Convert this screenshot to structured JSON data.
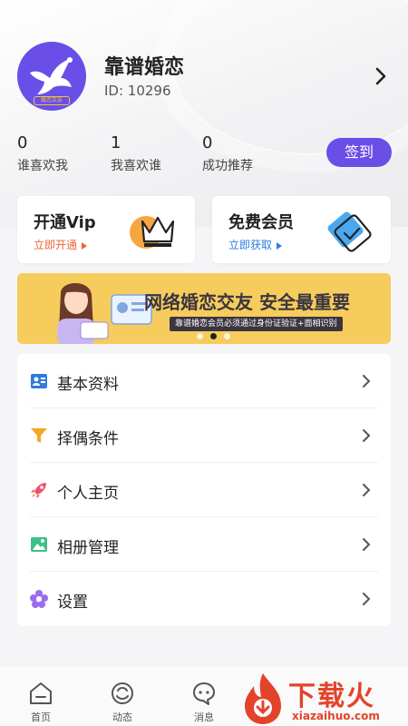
{
  "profile": {
    "app_name": "靠谱婚恋",
    "user_id": "ID: 10296",
    "avatar_badge": "婚恋交友"
  },
  "stats": [
    {
      "value": "0",
      "label": "谁喜欢我"
    },
    {
      "value": "1",
      "label": "我喜欢谁"
    },
    {
      "value": "0",
      "label": "成功推荐"
    }
  ],
  "checkin_label": "签到",
  "cards": {
    "vip": {
      "title": "开通Vip",
      "action": "立即开通",
      "accent": "#f0623a"
    },
    "free": {
      "title": "免费会员",
      "action": "立即获取",
      "accent": "#2f7be0"
    }
  },
  "banner": {
    "headline": "网络婚恋交友 安全最重要",
    "subline": "靠谱婚恋会员必须通过身份证验证+面相识别",
    "slides": 3,
    "active_slide": 2
  },
  "menu": [
    {
      "label": "基本资料",
      "icon": "profile-card-icon"
    },
    {
      "label": "择偶条件",
      "icon": "filter-icon"
    },
    {
      "label": "个人主页",
      "icon": "rocket-icon"
    },
    {
      "label": "相册管理",
      "icon": "photo-album-icon"
    },
    {
      "label": "设置",
      "icon": "settings-flower-icon"
    }
  ],
  "tabs": [
    {
      "label": "首页",
      "icon": "home-icon"
    },
    {
      "label": "动态",
      "icon": "moments-icon"
    },
    {
      "label": "消息",
      "icon": "message-icon"
    }
  ],
  "watermark": {
    "text": "下载火",
    "url": "xiazaihuo.com"
  },
  "colors": {
    "brand_purple": "#6a4ee8",
    "banner_yellow": "#f6cc5c"
  }
}
